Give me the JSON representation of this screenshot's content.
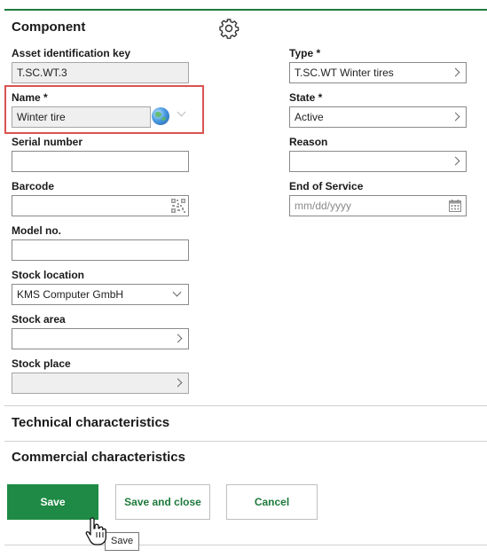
{
  "component": {
    "title": "Component",
    "settings_icon": "gear-icon",
    "asset_id": {
      "label": "Asset identification key",
      "value": "T.SC.WT.3"
    },
    "name": {
      "label": "Name *",
      "value": "Winter tire",
      "language_icon": "globe-icon"
    },
    "serial_number": {
      "label": "Serial number",
      "value": ""
    },
    "barcode": {
      "label": "Barcode",
      "value": "",
      "icon": "qr-code-icon"
    },
    "model_no": {
      "label": "Model no.",
      "value": ""
    },
    "stock_location": {
      "label": "Stock location",
      "value": "KMS Computer GmbH"
    },
    "stock_area": {
      "label": "Stock area",
      "value": ""
    },
    "stock_place": {
      "label": "Stock place",
      "value": ""
    },
    "type": {
      "label": "Type *",
      "value": "T.SC.WT Winter tires"
    },
    "state": {
      "label": "State *",
      "value": "Active"
    },
    "reason": {
      "label": "Reason",
      "value": ""
    },
    "end_of_service": {
      "label": "End of Service",
      "placeholder": "mm/dd/yyyy",
      "icon": "calendar-icon"
    }
  },
  "sections": {
    "technical": "Technical characteristics",
    "commercial": "Commercial characteristics"
  },
  "actions": {
    "save": "Save",
    "save_and_close": "Save and close",
    "cancel": "Cancel"
  },
  "tooltip": "Save",
  "colors": {
    "accent": "#1e8a45",
    "highlight": "#d9534f"
  }
}
